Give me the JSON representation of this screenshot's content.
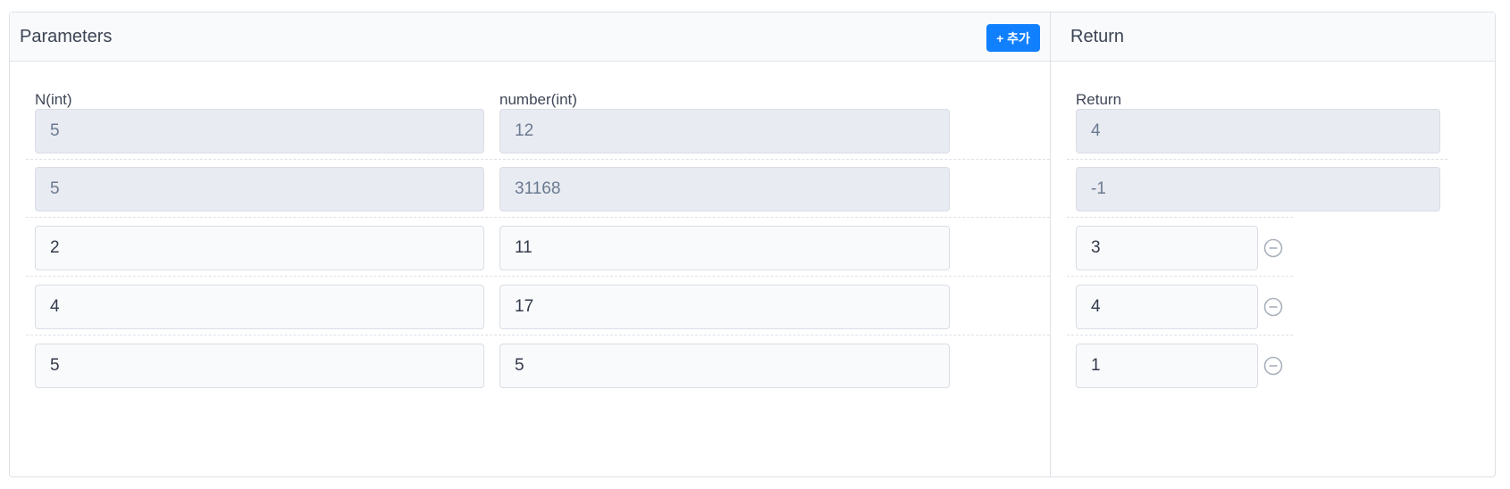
{
  "parameters": {
    "title": "Parameters",
    "add_label": "+ 추가",
    "columns": [
      {
        "label": "N(int)"
      },
      {
        "label": "number(int)"
      }
    ],
    "rows": [
      {
        "n": "5",
        "number": "12"
      },
      {
        "n": "5",
        "number": "31168"
      },
      {
        "n": "2",
        "number": "11"
      },
      {
        "n": "4",
        "number": "17"
      },
      {
        "n": "5",
        "number": "5"
      }
    ]
  },
  "returns": {
    "title": "Return",
    "column_label": "Return",
    "rows": [
      {
        "value": "4"
      },
      {
        "value": "-1"
      },
      {
        "value": "3"
      },
      {
        "value": "4"
      },
      {
        "value": "1"
      }
    ]
  },
  "icons": {
    "remove": "minus-circle-icon"
  }
}
